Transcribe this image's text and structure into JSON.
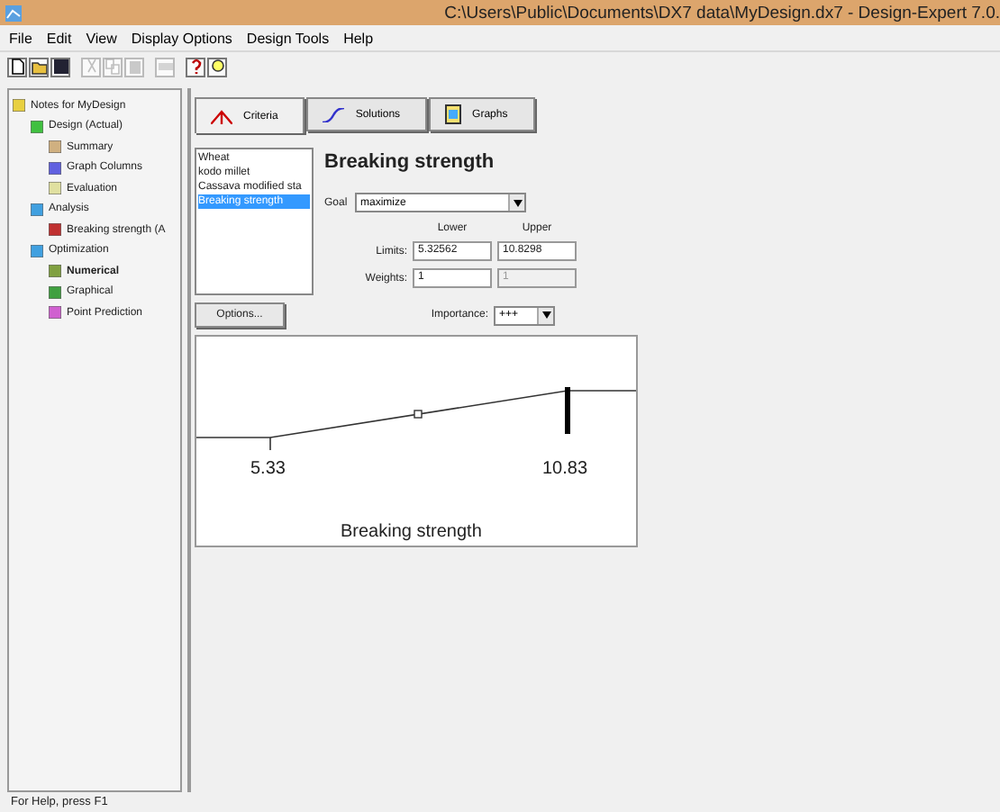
{
  "window": {
    "title": "C:\\Users\\Public\\Documents\\DX7 data\\MyDesign.dx7 - Design-Expert 7.0."
  },
  "menu": [
    "File",
    "Edit",
    "View",
    "Display Options",
    "Design Tools",
    "Help"
  ],
  "toolbar": [
    {
      "kind": "new",
      "disabled": false
    },
    {
      "kind": "open",
      "disabled": false
    },
    {
      "kind": "save",
      "disabled": false
    },
    {
      "kind": "cut",
      "disabled": true
    },
    {
      "kind": "copy",
      "disabled": true
    },
    {
      "kind": "paste",
      "disabled": true
    },
    {
      "kind": "print",
      "disabled": true
    },
    {
      "kind": "help",
      "disabled": false
    },
    {
      "kind": "tip",
      "disabled": false
    }
  ],
  "tree": [
    {
      "label": "Notes for MyDesign",
      "selected": false,
      "children": [
        {
          "label": "Design (Actual)",
          "selected": false,
          "children": [
            {
              "label": "Summary",
              "selected": false
            },
            {
              "label": "Graph Columns",
              "selected": false
            },
            {
              "label": "Evaluation",
              "selected": false
            }
          ]
        },
        {
          "label": "Analysis",
          "selected": false,
          "children": [
            {
              "label": "Breaking strength (A",
              "selected": false
            }
          ]
        },
        {
          "label": "Optimization",
          "selected": false,
          "children": [
            {
              "label": "Numerical",
              "selected": true
            },
            {
              "label": "Graphical",
              "selected": false
            },
            {
              "label": "Point Prediction",
              "selected": false
            }
          ]
        }
      ]
    }
  ],
  "tabs": [
    {
      "label": "Criteria",
      "selected": true
    },
    {
      "label": "Solutions",
      "selected": false
    },
    {
      "label": "Graphs",
      "selected": false
    }
  ],
  "responses": [
    {
      "label": "Wheat",
      "selected": false
    },
    {
      "label": "kodo millet",
      "selected": false
    },
    {
      "label": "Cassava modified sta",
      "selected": false
    },
    {
      "label": "Breaking strength",
      "selected": true
    }
  ],
  "criteria": {
    "heading": "Breaking strength",
    "goal_label": "Goal",
    "goal": "maximize",
    "lower_heading": "Lower",
    "upper_heading": "Upper",
    "limits_label": "Limits:",
    "lower_limit": "5.32562",
    "upper_limit": "10.8298",
    "weights_label": "Weights:",
    "lower_weight": "1",
    "upper_weight": "1",
    "upper_weight_disabled": true,
    "importance_label": "Importance:",
    "importance": "+++"
  },
  "options_button": "Options...",
  "ramp": {
    "low_label": "5.33",
    "high_label": "10.83",
    "axis_title": "Breaking strength"
  },
  "status_bar": "For Help, press F1"
}
